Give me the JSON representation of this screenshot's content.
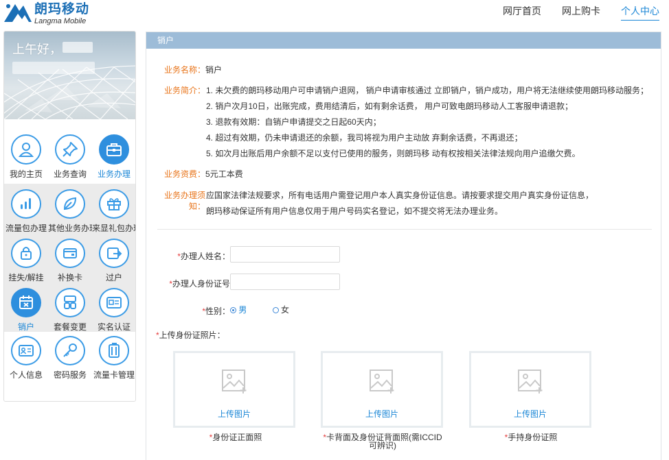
{
  "brand": {
    "name_cn": "朗玛移动",
    "name_en": "Langma Mobile"
  },
  "topnav": [
    {
      "label": "网厅首页",
      "active": false
    },
    {
      "label": "网上购卡",
      "active": false
    },
    {
      "label": "个人中心",
      "active": true
    }
  ],
  "sidebar": {
    "greeting": "上午好，",
    "main_tabs": [
      {
        "label": "我的主页",
        "icon": "user-icon"
      },
      {
        "label": "业务查询",
        "icon": "pin-icon"
      },
      {
        "label": "业务办理",
        "icon": "briefcase-icon",
        "active": true
      }
    ],
    "services": [
      {
        "label": "流量包办理",
        "icon": "signal-bars-icon"
      },
      {
        "label": "其他业务办理",
        "icon": "leaf-icon"
      },
      {
        "label": "来显礼包办理",
        "icon": "gift-icon"
      },
      {
        "label": "挂失/解挂",
        "icon": "lock-icon"
      },
      {
        "label": "补换卡",
        "icon": "card-icon"
      },
      {
        "label": "过户",
        "icon": "transfer-icon"
      },
      {
        "label": "销户",
        "icon": "calendar-x-icon",
        "active": true
      },
      {
        "label": "套餐变更",
        "icon": "package-icon"
      },
      {
        "label": "实名认证",
        "icon": "id-card-icon"
      }
    ],
    "bottom": [
      {
        "label": "个人信息",
        "icon": "profile-card-icon"
      },
      {
        "label": "密码服务",
        "icon": "key-icon"
      },
      {
        "label": "流量卡管理",
        "icon": "sim-cards-icon"
      }
    ]
  },
  "panel": {
    "title": "销户",
    "name_label": "业务名称：",
    "name_value": "销户",
    "intro_label": "业务简介：",
    "intro_lines": [
      "1. 未欠费的朗玛移动用户可申请销户退网， 销户申请审核通过 立即销户，销户成功，用户将无法继续使用朗玛移动服务；",
      "2. 销户次月10日，出账完成，费用结清后，如有剩余话费， 用户可致电朗玛移动人工客服申请退款；",
      "3. 退款有效期：自销户申请提交之日起60天内；",
      "4. 超过有效期，仍未申请退还的余额，我司将视为用户主动放 弃剩余话费，不再退还；",
      "5. 如次月出账后用户余额不足以支付已使用的服务，则朗玛移 动有权按相关法律法规向用户追缴欠费。"
    ],
    "fee_label": "业务资费：",
    "fee_value": "5元工本费",
    "notice_label_1": "业务办理须",
    "notice_label_2": "知：",
    "notice_lines": [
      "应国家法律法规要求，所有电话用户需登记用户本人真实身份证信息。请按要求提交用户真实身份证信息，",
      "朗玛移动保证所有用户信息仅用于用户号码实名登记，如不提交将无法办理业务。"
    ]
  },
  "form": {
    "required_mark": "*",
    "name_label": "办理人姓名：",
    "id_label": "办理人身份证号",
    "gender_label": "性别：",
    "gender_male": "男",
    "gender_female": "女",
    "upload_label": "上传身份证照片：",
    "upload_button": "上传图片",
    "uploads": [
      {
        "caption": "身份证正面照"
      },
      {
        "caption": "卡背面及身份证背面照(需ICCID可辨识)"
      },
      {
        "caption": "手持身份证照"
      }
    ]
  }
}
